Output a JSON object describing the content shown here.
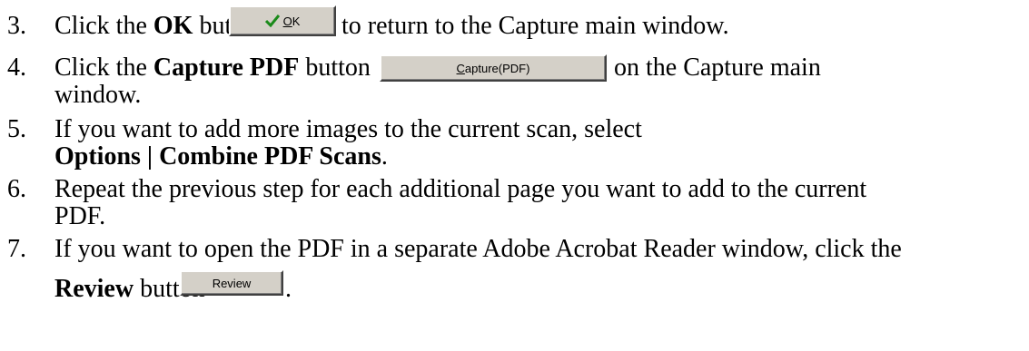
{
  "steps": [
    {
      "number": "3.",
      "before": "Click the ",
      "bold": "OK",
      "middle": " button ",
      "after": "to return to the Capture main window."
    },
    {
      "number": "4.",
      "before": "Click the ",
      "bold": "Capture PDF",
      "middle": " button ",
      "after": "on the Capture main",
      "line2": "window."
    },
    {
      "number": "5.",
      "line1": "If you want to add more images to the current scan, select",
      "line2_bold": "Options | Combine PDF Scans",
      "line2_end": "."
    },
    {
      "number": "6.",
      "line1": "Repeat the previous step for each additional page you want to add to the current",
      "line2": "PDF."
    },
    {
      "number": "7.",
      "line1": "If you want to open the PDF in a separate Adobe Acrobat Reader window, click the",
      "line2_bold": "Review",
      "line2_mid": " button ",
      "line2_end": "."
    }
  ],
  "buttons": {
    "ok": {
      "ul": "O",
      "rest": "K",
      "icon": "checkmark-icon",
      "icon_color": "#1a8a1a"
    },
    "capture": {
      "ul": "C",
      "rest": "apture(PDF)"
    },
    "review": {
      "label": "Review"
    }
  }
}
